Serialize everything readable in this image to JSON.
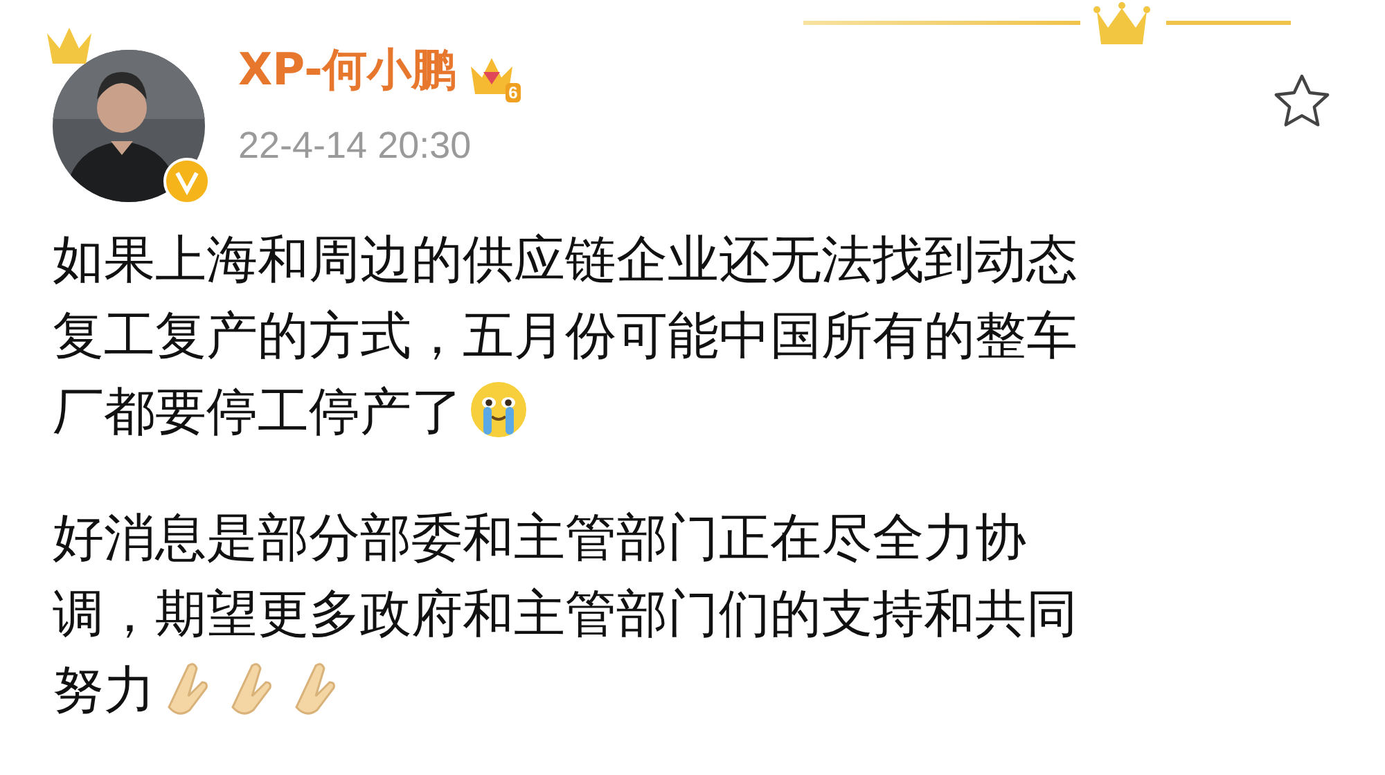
{
  "post": {
    "author": {
      "name": "XP-何小鹏",
      "level_badge": "6",
      "verified": true
    },
    "time": "22-4-14 20:30",
    "favorited": false,
    "paragraphs": [
      {
        "text": "如果上海和周边的供应链企业还无法找到动态复工复产的方式，五月份可能中国所有的整车厂都要停工停产了",
        "emoji": [
          {
            "kind": "crying"
          }
        ]
      },
      {
        "text": "好消息是部分部委和主管部门正在尽全力协调，期望更多政府和主管部门们的支持和共同努力",
        "emoji": [
          {
            "kind": "clap"
          },
          {
            "kind": "clap"
          },
          {
            "kind": "clap"
          }
        ]
      }
    ]
  }
}
